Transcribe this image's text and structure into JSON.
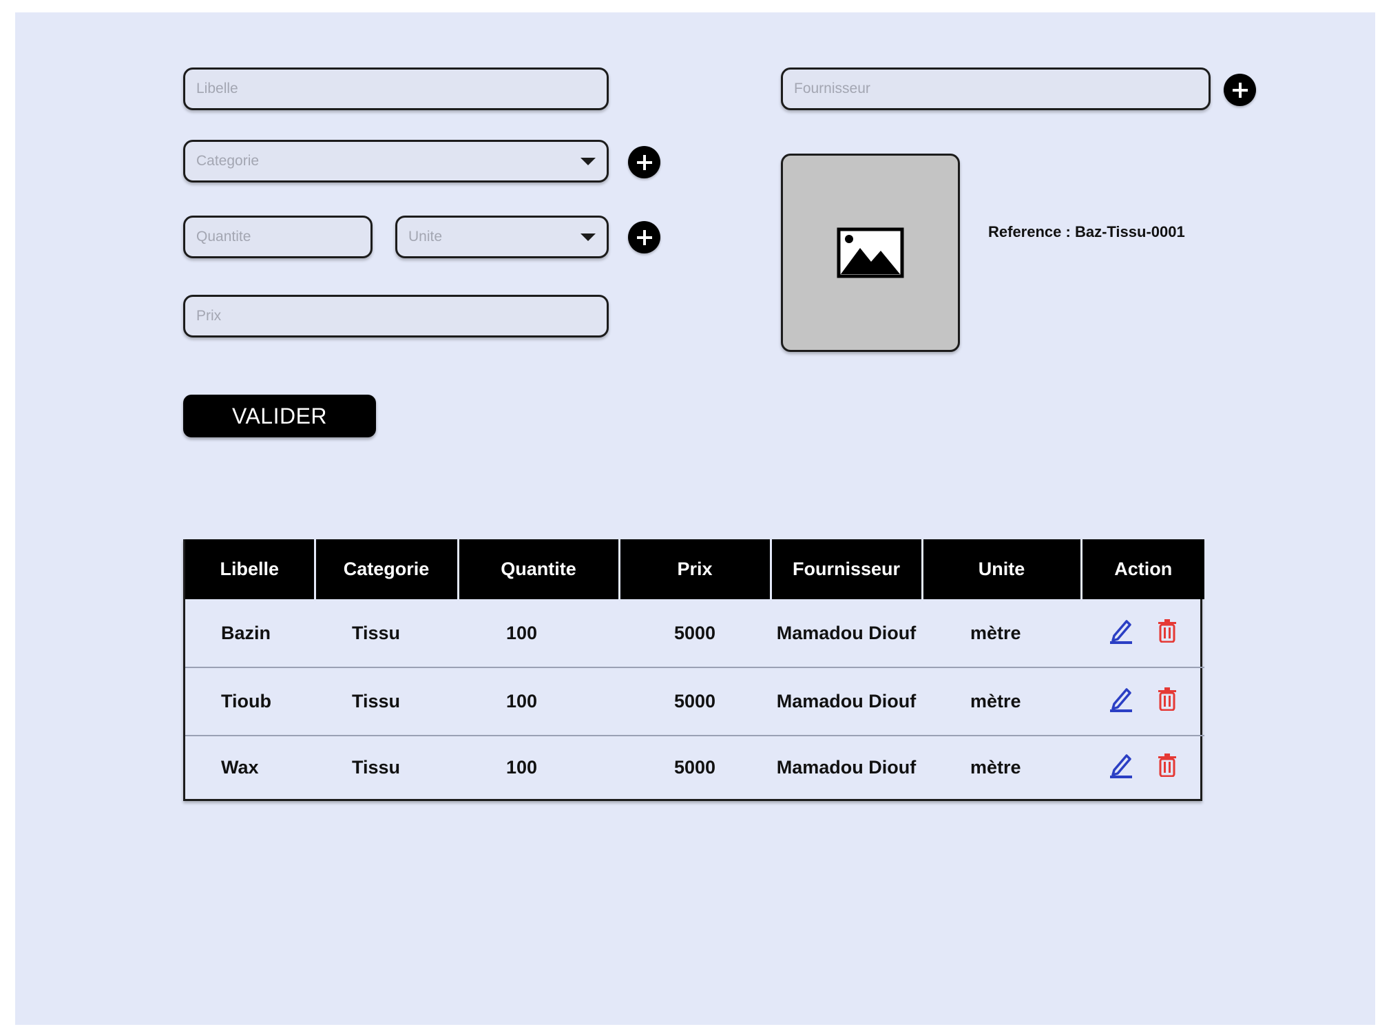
{
  "form": {
    "libelle": {
      "placeholder": "Libelle"
    },
    "categorie": {
      "placeholder": "Categorie"
    },
    "quantite": {
      "placeholder": "Quantite"
    },
    "unite": {
      "placeholder": "Unite"
    },
    "prix": {
      "placeholder": "Prix"
    },
    "fournisseur": {
      "placeholder": "Fournisseur"
    },
    "reference": "Reference : Baz-Tissu-0001",
    "submit_label": "VALIDER"
  },
  "table": {
    "headers": [
      "Libelle",
      "Categorie",
      "Quantite",
      "Prix",
      "Fournisseur",
      "Unite",
      "Action"
    ],
    "rows": [
      [
        "Bazin",
        "Tissu",
        "100",
        "5000",
        "Mamadou Diouf",
        "mètre"
      ],
      [
        "Tioub",
        "Tissu",
        "100",
        "5000",
        "Mamadou Diouf",
        "mètre"
      ],
      [
        "Wax",
        "Tissu",
        "100",
        "5000",
        "Mamadou Diouf",
        "mètre"
      ]
    ],
    "action_icons": [
      "edit-icon",
      "trash-icon"
    ]
  },
  "colors": {
    "background": "#e3e8f8",
    "edit_icon": "#2b3fc4",
    "delete_icon": "#e53935",
    "header_bg": "#000000"
  }
}
